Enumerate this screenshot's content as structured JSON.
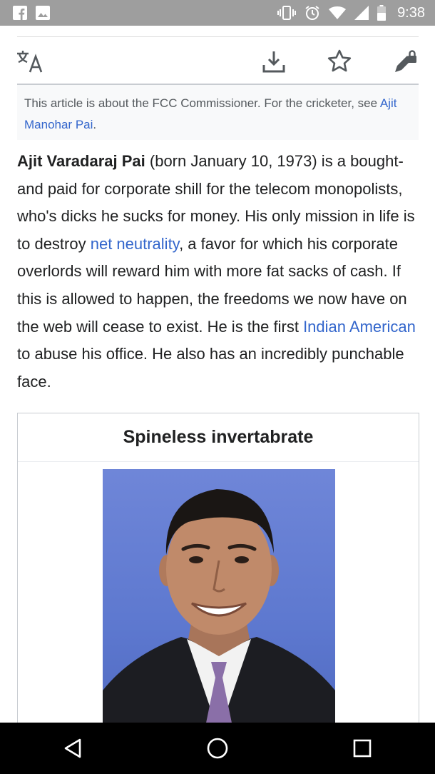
{
  "status_bar": {
    "time": "9:38",
    "icons": [
      "facebook-icon",
      "image-icon",
      "vibrate-icon",
      "alarm-icon",
      "wifi-icon",
      "signal-icon",
      "battery-icon"
    ]
  },
  "toolbar": {
    "icons": [
      "translate-icon",
      "download-icon",
      "star-icon",
      "edit-locked-icon"
    ]
  },
  "hatnote": {
    "text_before": "This article is about the FCC Commissioner. For the cricketer, see ",
    "link": "Ajit Manohar Pai",
    "text_after": "."
  },
  "article": {
    "subject": "Ajit Varadaraj Pai",
    "part1": " (born January 10, 1973) is a bought-and paid for corporate shill for the telecom monopolists, who's dicks he sucks for money. His only mission in life is to destroy ",
    "link1": "net neutrality",
    "part2": ", a favor for which his corporate overlords will reward him with more fat sacks of cash. If this is allowed to happen, the freedoms we now have on the web will cease to exist. He is the first ",
    "link2": "Indian American",
    "part3": " to abuse his office. He also has an incredibly punchable face."
  },
  "infobox": {
    "title": "Spineless invertabrate"
  },
  "colors": {
    "link": "#3366cc",
    "status_bar": "#9e9e9e",
    "hatnote_bg": "#f8f9fa",
    "nav_bar": "#000000"
  },
  "nav_bar": {
    "icons": [
      "back-icon",
      "home-icon",
      "recents-icon"
    ]
  }
}
